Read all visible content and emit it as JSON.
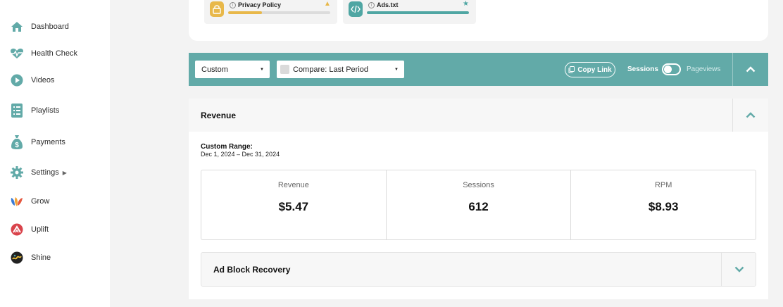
{
  "sidebar": {
    "items": [
      {
        "label": "Dashboard",
        "icon": "home-icon"
      },
      {
        "label": "Health Check",
        "icon": "heartbeat-icon"
      },
      {
        "label": "Videos",
        "icon": "play-icon"
      },
      {
        "label": "Playlists",
        "icon": "list-icon"
      },
      {
        "label": "Payments",
        "icon": "money-bag-icon"
      },
      {
        "label": "Settings",
        "icon": "gear-icon"
      },
      {
        "label": "Grow",
        "icon": "grow-logo-icon"
      },
      {
        "label": "Uplift",
        "icon": "uplift-logo-icon"
      },
      {
        "label": "Shine",
        "icon": "shine-logo-icon"
      }
    ],
    "icon_color": "#62aaa8"
  },
  "checks": [
    {
      "label": "Privacy Policy",
      "icon": "lock-icon",
      "status_icon": "warning-icon",
      "progress": 0.33,
      "color": "#e8b84a"
    },
    {
      "label": "Ads.txt",
      "icon": "code-icon",
      "status_icon": "star-icon",
      "progress": 1.0,
      "color": "#4fa6a3"
    }
  ],
  "filters": {
    "date_range": "Custom",
    "compare": "Compare: Last Period",
    "compare_checked": false,
    "copy_link": "Copy Link",
    "toggle_left": "Sessions",
    "toggle_right": "Pageviews",
    "toggle_on": false,
    "bar_color": "#62aaa8"
  },
  "revenue": {
    "title": "Revenue",
    "range_label": "Custom Range:",
    "range_dates": "Dec 1, 2024 – Dec 31, 2024",
    "metrics": [
      {
        "label": "Revenue",
        "value": "$5.47"
      },
      {
        "label": "Sessions",
        "value": "612"
      },
      {
        "label": "RPM",
        "value": "$8.93"
      }
    ]
  },
  "adblock": {
    "title": "Ad Block Recovery"
  }
}
